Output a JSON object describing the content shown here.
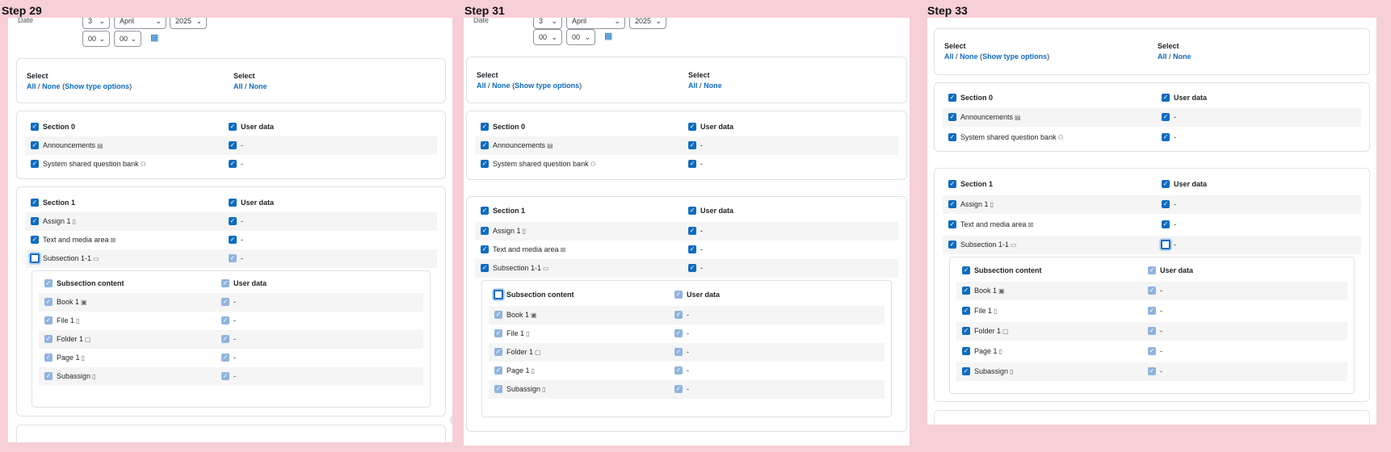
{
  "steps": [
    "Step 29",
    "Step 31",
    "Step 33"
  ],
  "date": {
    "label": "Date",
    "day": "3",
    "month": "April",
    "year": "2025",
    "hour": "00",
    "minute": "00"
  },
  "select": {
    "label": "Select",
    "all": "All",
    "slash": "/",
    "none": "None",
    "show_type_options": "Show type options",
    "paren_open": "(",
    "paren_close": ")"
  },
  "user_data_label": "User data",
  "dash": "-",
  "section0": {
    "title": "Section 0",
    "items": [
      {
        "label": "Announcements",
        "icon": "forum-icon",
        "glyph": "▤"
      },
      {
        "label": "System shared question bank",
        "icon": "question-bank-icon",
        "glyph": "⚇"
      }
    ]
  },
  "section1": {
    "title": "Section 1",
    "items": [
      {
        "label": "Assign 1",
        "icon": "assign-icon",
        "glyph": "▯"
      },
      {
        "label": "Text and media area",
        "icon": "label-icon",
        "glyph": "⊠"
      },
      {
        "label": "Subsection 1-1",
        "icon": "subsection-icon",
        "glyph": "▭"
      }
    ]
  },
  "subsection": {
    "title": "Subsection content",
    "items": [
      {
        "label": "Book 1",
        "icon": "book-icon",
        "glyph": "▣"
      },
      {
        "label": "File 1",
        "icon": "file-icon",
        "glyph": "▯"
      },
      {
        "label": "Folder 1",
        "icon": "folder-icon",
        "glyph": "▢"
      },
      {
        "label": "Page 1",
        "icon": "page-icon",
        "glyph": "▯"
      },
      {
        "label": "Subassign",
        "icon": "subassign-icon",
        "glyph": "▯"
      }
    ]
  },
  "colors": {
    "accent": "#0f6cbf",
    "light_check": "#8fb4de",
    "background": "#f7cfd6"
  }
}
